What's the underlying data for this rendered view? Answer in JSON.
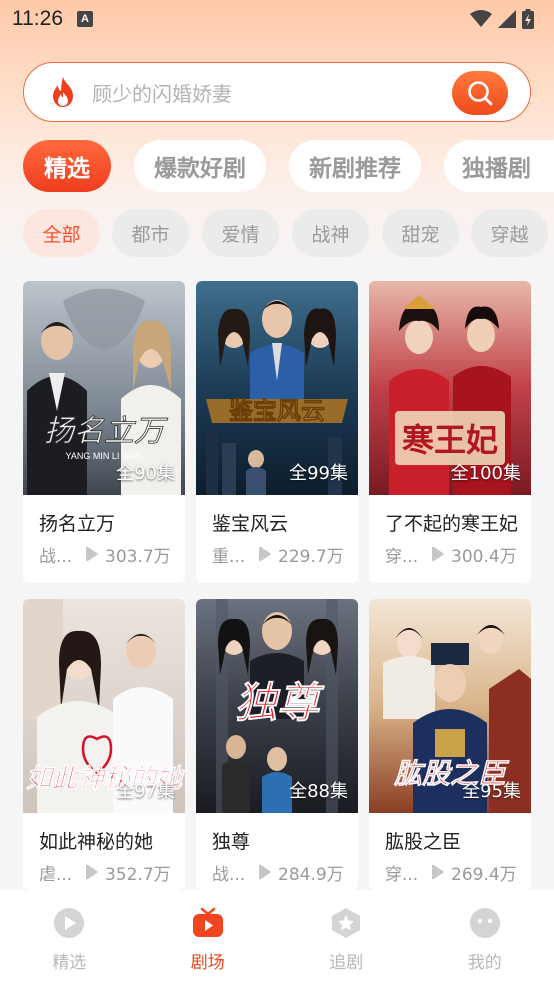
{
  "status": {
    "time": "11:26",
    "notif_letter": "A"
  },
  "search": {
    "placeholder": "顾少的闪婚娇妻"
  },
  "tabs": [
    {
      "label": "精选",
      "active": true
    },
    {
      "label": "爆款好剧",
      "active": false
    },
    {
      "label": "新剧推荐",
      "active": false
    },
    {
      "label": "独播剧",
      "active": false
    }
  ],
  "categories": [
    {
      "label": "全部",
      "active": true
    },
    {
      "label": "都市",
      "active": false
    },
    {
      "label": "爱情",
      "active": false
    },
    {
      "label": "战神",
      "active": false
    },
    {
      "label": "甜宠",
      "active": false
    },
    {
      "label": "穿越",
      "active": false
    }
  ],
  "dramas": [
    {
      "title": "扬名立万",
      "episodes": "全90集",
      "genre": "战...",
      "views": "303.7万",
      "poster_text": "扬名立万"
    },
    {
      "title": "鉴宝风云",
      "episodes": "全99集",
      "genre": "重...",
      "views": "229.7万",
      "poster_text": "鉴宝风云"
    },
    {
      "title": "了不起的寒王妃",
      "episodes": "全100集",
      "genre": "穿...",
      "views": "300.4万",
      "poster_text": "寒王妃"
    },
    {
      "title": "如此神秘的她",
      "episodes": "全97集",
      "genre": "虐...",
      "views": "352.7万",
      "poster_text": "如此神秘的她"
    },
    {
      "title": "独尊",
      "episodes": "全88集",
      "genre": "战...",
      "views": "284.9万",
      "poster_text": "独尊"
    },
    {
      "title": "肱股之臣",
      "episodes": "全95集",
      "genre": "穿...",
      "views": "269.4万",
      "poster_text": "肱股之臣"
    }
  ],
  "bottom_nav": [
    {
      "label": "精选",
      "icon": "play-circle-icon",
      "active": false
    },
    {
      "label": "剧场",
      "icon": "tv-icon",
      "active": true
    },
    {
      "label": "追剧",
      "icon": "star-badge-icon",
      "active": false
    },
    {
      "label": "我的",
      "icon": "face-icon",
      "active": false
    }
  ],
  "colors": {
    "accent": "#f0451f",
    "inactive": "#b8b8b8"
  }
}
